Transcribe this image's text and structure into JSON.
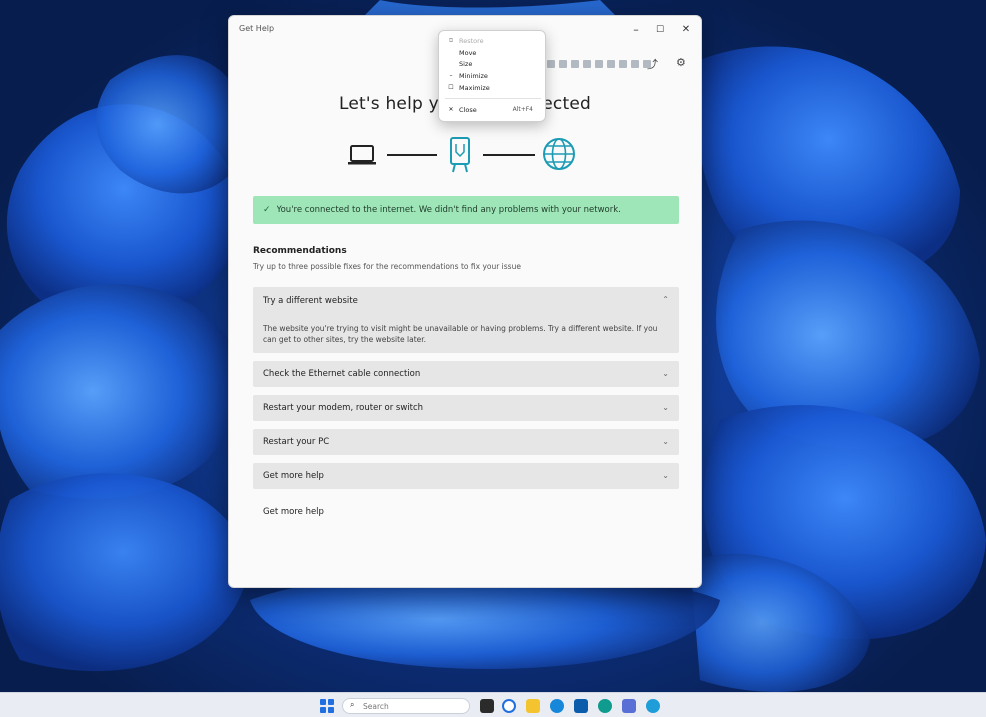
{
  "window": {
    "title": "Get Help",
    "controls": {
      "minimize": "–",
      "maximize": "☐",
      "close": "✕"
    }
  },
  "toolbar": {
    "share_icon": "share-icon",
    "settings_icon": "gear-icon"
  },
  "context_menu": {
    "items": [
      {
        "icon": "restore-icon",
        "label": "Restore"
      },
      {
        "icon": "move-icon",
        "label": "Move"
      },
      {
        "icon": "size-icon",
        "label": "Size"
      },
      {
        "icon": "minimize-icon",
        "label": "Minimize"
      },
      {
        "icon": "maximize-icon",
        "label": "Maximize"
      },
      {
        "icon": "close-icon",
        "label": "Close",
        "shortcut": "Alt+F4"
      }
    ]
  },
  "main": {
    "heading": "Let's help you get connected",
    "diagram": {
      "nodes": [
        "laptop-icon",
        "router-icon",
        "globe-icon"
      ],
      "accent_color": "#1c9bb4"
    },
    "status": {
      "check_icon": "check-icon",
      "text": "You're connected to the internet. We didn't find any problems with your network.",
      "background": "#9ee6b8"
    },
    "recommendations": {
      "title": "Recommendations",
      "subtitle": "Try up to three possible fixes for the recommendations to fix your issue",
      "items": [
        {
          "label": "Try a different website",
          "expanded": true,
          "description": "The website you're trying to visit might be unavailable or having problems. Try a different website. If you can get to other sites, try the website later."
        },
        {
          "label": "Check the Ethernet cable connection",
          "expanded": false
        },
        {
          "label": "Restart your modem, router or switch",
          "expanded": false
        },
        {
          "label": "Restart your PC",
          "expanded": false
        },
        {
          "label": "Get more help",
          "expanded": false
        }
      ]
    },
    "footer_link": "Get more help"
  },
  "taskbar": {
    "search_placeholder": "Search",
    "apps": [
      "file-explorer-icon",
      "edge-icon",
      "folder-icon",
      "edge-browser-icon",
      "store-icon",
      "settings-icon",
      "teams-icon",
      "app-icon"
    ]
  },
  "colors": {
    "wallpaper": "#1b5fd6",
    "banner": "#9ee6b8",
    "accent": "#1f6fe0"
  }
}
